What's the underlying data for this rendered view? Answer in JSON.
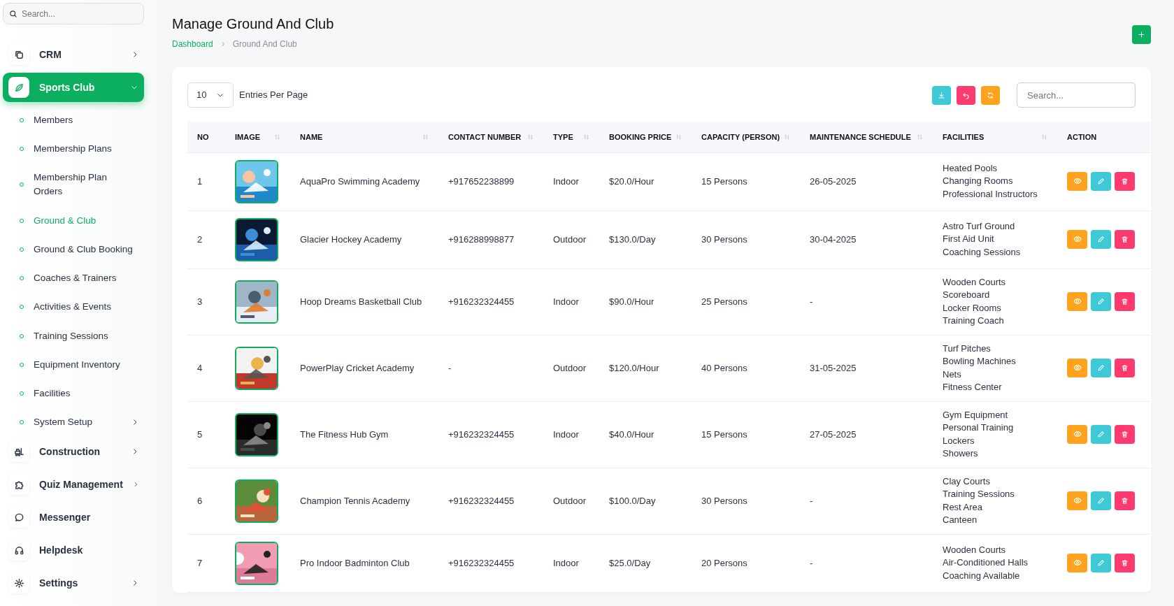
{
  "sidebar": {
    "search": {
      "placeholder": "Search..."
    },
    "items": [
      {
        "label": "CRM",
        "submenu": true,
        "expanded": false,
        "selected": false
      },
      {
        "label": "Sports Club",
        "submenu": true,
        "expanded": true,
        "selected": true,
        "children": [
          {
            "label": "Members",
            "selected": false,
            "submenu": false
          },
          {
            "label": "Membership Plans",
            "selected": false,
            "submenu": false
          },
          {
            "label": "Membership Plan Orders",
            "selected": false,
            "submenu": false
          },
          {
            "label": "Ground & Club",
            "selected": true,
            "submenu": false
          },
          {
            "label": "Ground & Club Booking",
            "selected": false,
            "submenu": false
          },
          {
            "label": "Coaches & Trainers",
            "selected": false,
            "submenu": false
          },
          {
            "label": "Activities & Events",
            "selected": false,
            "submenu": false
          },
          {
            "label": "Training Sessions",
            "selected": false,
            "submenu": false
          },
          {
            "label": "Equipment Inventory",
            "selected": false,
            "submenu": false
          },
          {
            "label": "Facilities",
            "selected": false,
            "submenu": false
          },
          {
            "label": "System Setup",
            "selected": false,
            "submenu": true
          }
        ]
      },
      {
        "label": "Construction",
        "submenu": true,
        "expanded": false,
        "selected": false
      },
      {
        "label": "Quiz Management",
        "submenu": true,
        "expanded": false,
        "selected": false
      },
      {
        "label": "Messenger",
        "submenu": false,
        "expanded": false,
        "selected": false
      },
      {
        "label": "Helpdesk",
        "submenu": false,
        "expanded": false,
        "selected": false
      },
      {
        "label": "Settings",
        "submenu": true,
        "expanded": false,
        "selected": false
      }
    ]
  },
  "page": {
    "title": "Manage Ground And Club",
    "breadcrumb": [
      {
        "label": "Dashboard",
        "kind": "link"
      },
      {
        "label": "Ground And Club",
        "kind": "current"
      }
    ]
  },
  "table": {
    "entries": {
      "value": "10",
      "label": "Entries Per Page"
    },
    "search": {
      "placeholder": "Search..."
    },
    "columns": [
      {
        "label": "NO",
        "sortable": false
      },
      {
        "label": "IMAGE",
        "sortable": true
      },
      {
        "label": "NAME",
        "sortable": true
      },
      {
        "label": "CONTACT NUMBER",
        "sortable": true
      },
      {
        "label": "TYPE",
        "sortable": true
      },
      {
        "label": "BOOKING PRICE",
        "sortable": true
      },
      {
        "label": "CAPACITY (PERSON)",
        "sortable": true
      },
      {
        "label": "MAINTENANCE SCHEDULE",
        "sortable": true
      },
      {
        "label": "FACILITIES",
        "sortable": true
      },
      {
        "label": "ACTION",
        "sortable": false
      }
    ],
    "rows": [
      {
        "no": "1",
        "image": {
          "kind": "picture"
        },
        "name": "AquaPro Swimming Academy",
        "contact": "+917652238899",
        "type": "Indoor",
        "booking_price": "$20.0/Hour",
        "capacity": "15 Persons",
        "maintenance": "26-05-2025",
        "facilities": [
          "Heated Pools",
          "Changing Rooms",
          "Professional Instructors"
        ]
      },
      {
        "no": "2",
        "image": {
          "kind": "picture"
        },
        "name": "Glacier Hockey Academy",
        "contact": "+916288998877",
        "type": "Outdoor",
        "booking_price": "$130.0/Day",
        "capacity": "30 Persons",
        "maintenance": "30-04-2025",
        "facilities": [
          "Astro Turf Ground",
          "First Aid Unit",
          "Coaching Sessions"
        ]
      },
      {
        "no": "3",
        "image": {
          "kind": "picture"
        },
        "name": "Hoop Dreams Basketball Club",
        "contact": "+916232324455",
        "type": "Indoor",
        "booking_price": "$90.0/Hour",
        "capacity": "25 Persons",
        "maintenance": "-",
        "facilities": [
          "Wooden Courts",
          "Scoreboard",
          "Locker Rooms",
          "Training Coach"
        ]
      },
      {
        "no": "4",
        "image": {
          "kind": "picture"
        },
        "name": "PowerPlay Cricket Academy",
        "contact": "-",
        "type": "Outdoor",
        "booking_price": "$120.0/Hour",
        "capacity": "40 Persons",
        "maintenance": "31-05-2025",
        "facilities": [
          "Turf Pitches",
          "Bowling Machines",
          "Nets",
          "Fitness Center"
        ]
      },
      {
        "no": "5",
        "image": {
          "kind": "picture"
        },
        "name": "The Fitness Hub Gym",
        "contact": "+916232324455",
        "type": "Indoor",
        "booking_price": "$40.0/Hour",
        "capacity": "15 Persons",
        "maintenance": "27-05-2025",
        "facilities": [
          "Gym Equipment",
          "Personal Training",
          "Lockers",
          "Showers"
        ]
      },
      {
        "no": "6",
        "image": {
          "kind": "picture"
        },
        "name": "Champion Tennis Academy",
        "contact": "+916232324455",
        "type": "Outdoor",
        "booking_price": "$100.0/Day",
        "capacity": "30 Persons",
        "maintenance": "-",
        "facilities": [
          "Clay Courts",
          "Training Sessions",
          "Rest Area",
          "Canteen"
        ]
      },
      {
        "no": "7",
        "image": {
          "kind": "picture"
        },
        "name": "Pro Indoor Badminton Club",
        "contact": "+916232324455",
        "type": "Indoor",
        "booking_price": "$25.0/Day",
        "capacity": "20 Persons",
        "maintenance": "-",
        "facilities": [
          "Wooden Courts",
          "Air-Conditioned Halls",
          "Coaching Available"
        ]
      }
    ]
  }
}
